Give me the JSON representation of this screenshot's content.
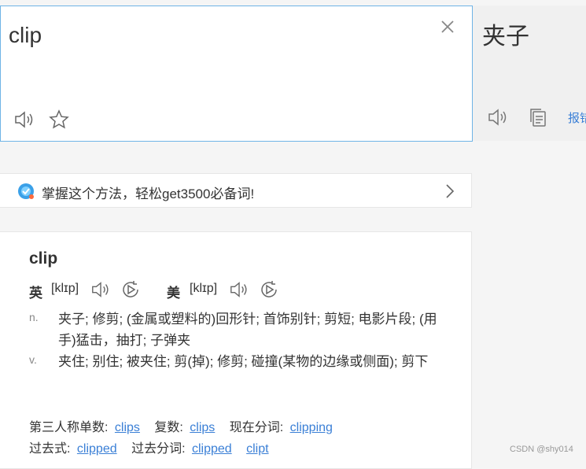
{
  "input": {
    "query": "clip",
    "clear_icon": "close-icon",
    "speaker_icon": "speaker-icon",
    "favorite_icon": "star-icon"
  },
  "result": {
    "translation": "夹子",
    "report_label": "报错"
  },
  "promo": {
    "text": "掌握这个方法，轻松get3500必备词!"
  },
  "dictionary": {
    "headword": "clip",
    "uk_label": "英",
    "uk_ipa": "[klɪp]",
    "us_label": "美",
    "us_ipa": "[klɪp]",
    "definitions": [
      {
        "pos": "n.",
        "text": "夹子; 修剪; (金属或塑料的)回形针; 首饰别针; 剪短; 电影片段; (用手)猛击，抽打; 子弹夹"
      },
      {
        "pos": "v.",
        "text": "夹住; 别住; 被夹住; 剪(掉); 修剪; 碰撞(某物的边缘或侧面); 剪下"
      }
    ],
    "forms": {
      "third_person_label": "第三人称单数:",
      "third_person": "clips",
      "plural_label": "复数:",
      "plural": "clips",
      "present_participle_label": "现在分词:",
      "present_participle": "clipping",
      "past_label": "过去式:",
      "past": "clipped",
      "past_participle_label": "过去分词:",
      "past_participle": "clipped",
      "past_participle_alt": "clipt"
    }
  },
  "watermark": "CSDN @shy014",
  "colors": {
    "accent": "#3a7fd6",
    "border_focus": "#6fb4e6"
  }
}
